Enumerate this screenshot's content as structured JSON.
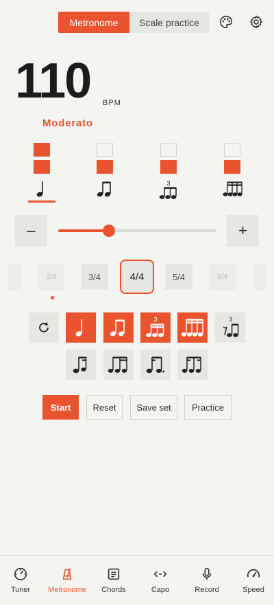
{
  "header": {
    "tabs": [
      {
        "label": "Metronome",
        "active": true
      },
      {
        "label": "Scale practice",
        "active": false
      }
    ],
    "icons": [
      "palette-icon",
      "gear-icon"
    ]
  },
  "tempo": {
    "bpm": "110",
    "unit": "BPM",
    "marking": "Moderato"
  },
  "subdivisions": [
    {
      "name": "quarter",
      "beats": [
        true,
        true
      ],
      "selected": true
    },
    {
      "name": "eighths",
      "beats": [
        false,
        true
      ]
    },
    {
      "name": "triplet",
      "beats": [
        false,
        true
      ],
      "tuplet": "3"
    },
    {
      "name": "sixteenths",
      "beats": [
        false,
        true
      ]
    }
  ],
  "slider": {
    "minus": "–",
    "plus": "+",
    "value_fraction": 0.32
  },
  "time_signatures": [
    {
      "label": "",
      "state": "dim"
    },
    {
      "label": "2/4",
      "state": "dim"
    },
    {
      "label": "3/4",
      "state": "normal"
    },
    {
      "label": "4/4",
      "state": "selected"
    },
    {
      "label": "5/4",
      "state": "normal"
    },
    {
      "label": "6/4",
      "state": "dim"
    },
    {
      "label": "",
      "state": "dim"
    }
  ],
  "rhythms": {
    "row1": [
      {
        "name": "loop",
        "on": false
      },
      {
        "name": "quarter",
        "on": true
      },
      {
        "name": "eighths",
        "on": true
      },
      {
        "name": "triplet",
        "on": true,
        "tuplet": "3"
      },
      {
        "name": "sixteenths",
        "on": true
      },
      {
        "name": "triplet-rest",
        "on": false,
        "tuplet": "3"
      }
    ],
    "row2": [
      {
        "name": "eighth-rest-eighth",
        "on": false
      },
      {
        "name": "eighth-two-sixteenths",
        "on": false
      },
      {
        "name": "dotted-eighth-sixteenth",
        "on": false
      },
      {
        "name": "sixteenth-eighth-sixteenth",
        "on": false
      }
    ]
  },
  "actions": {
    "start": "Start",
    "reset": "Reset",
    "save_set": "Save set",
    "practice": "Practice"
  },
  "nav": [
    {
      "label": "Tuner",
      "icon": "tuner-icon",
      "active": false
    },
    {
      "label": "Metronome",
      "icon": "metronome-icon",
      "active": true
    },
    {
      "label": "Chords",
      "icon": "chords-icon",
      "active": false
    },
    {
      "label": "Capo",
      "icon": "capo-icon",
      "active": false
    },
    {
      "label": "Record",
      "icon": "microphone-icon",
      "active": false
    },
    {
      "label": "Speed",
      "icon": "speed-icon",
      "active": false
    }
  ],
  "colors": {
    "accent": "#e9542f",
    "background": "#f4f4f0",
    "tile": "#e6e6e2"
  }
}
